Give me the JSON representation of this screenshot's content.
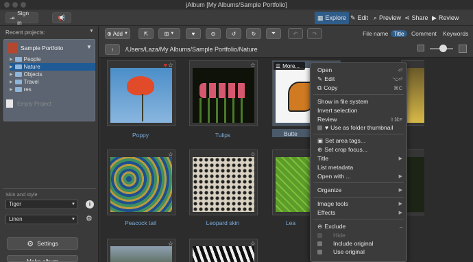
{
  "window": {
    "title": "jAlbum [My Albums/Sample Portfolio]"
  },
  "toolbar": {
    "sign_in": "Sign in",
    "nav": [
      "Explore",
      "Edit",
      "Preview",
      "Share",
      "Review"
    ]
  },
  "sidebar": {
    "recent_projects_label": "Recent projects:",
    "project_name": "Sample Portfolio",
    "tree": [
      {
        "label": "People",
        "selected": false
      },
      {
        "label": "Nature",
        "selected": true
      },
      {
        "label": "Objects",
        "selected": false
      },
      {
        "label": "Travel",
        "selected": false
      },
      {
        "label": "res",
        "selected": false
      }
    ],
    "empty_project": "Empty Project",
    "skin_style_label": "Skin and style",
    "skin": "Tiger",
    "style": "Linen",
    "settings_label": "Settings",
    "make_album_label": "Make album"
  },
  "actionbar": {
    "add_label": "Add",
    "sort_options": [
      "File name",
      "Title",
      "Comment",
      "Keywords"
    ],
    "sort_active": "Title"
  },
  "path": "/Users/Laza/My Albums/Sample Portfolio/Nature",
  "thumbs": [
    {
      "caption": "Poppy"
    },
    {
      "caption": "Tulips"
    },
    {
      "caption": "Butte"
    },
    {
      "caption": "Peacock tail"
    },
    {
      "caption": "Leopard skin"
    },
    {
      "caption": "Lea"
    }
  ],
  "hover_more_label": "More...",
  "context_menu": [
    {
      "label": "Open",
      "shortcut": "⏎"
    },
    {
      "label": "Edit",
      "shortcut": "⌥⏎"
    },
    {
      "label": "Copy",
      "shortcut": "⌘C"
    },
    {
      "label": "Show in file system"
    },
    {
      "label": "Invert selection"
    },
    {
      "label": "Review",
      "shortcut": "⇧⌘F"
    },
    {
      "label": "Use as folder thumbnail"
    },
    {
      "label": "Set area tags..."
    },
    {
      "label": "Set crop focus..."
    },
    {
      "label": "Title"
    },
    {
      "label": "List metadata"
    },
    {
      "label": "Open with ..."
    },
    {
      "label": "Organize"
    },
    {
      "label": "Image tools"
    },
    {
      "label": "Effects"
    },
    {
      "label": "Exclude"
    },
    {
      "label": "Hide"
    },
    {
      "label": "Include original"
    },
    {
      "label": "Use original"
    }
  ],
  "colors": {
    "accent": "#2f5d8a",
    "caption": "#7aaede",
    "selection": "#1e5a96"
  }
}
